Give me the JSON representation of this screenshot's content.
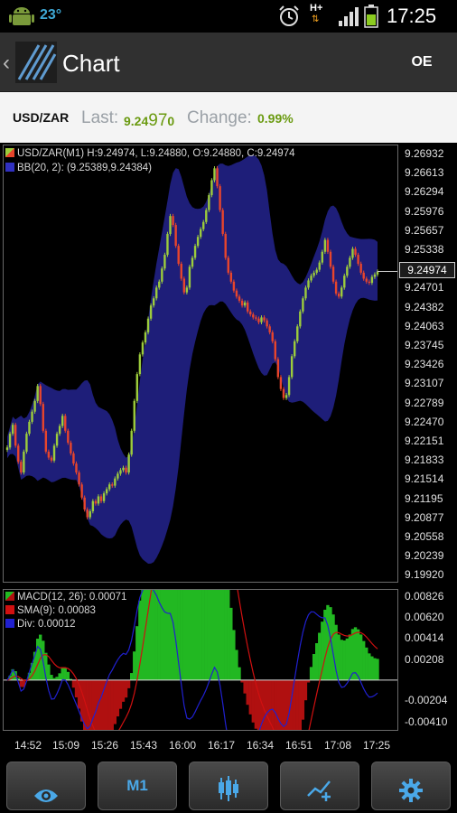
{
  "status_bar": {
    "temperature": "23°",
    "network": "H+",
    "time": "17:25"
  },
  "action_bar": {
    "title": "Chart",
    "oe_label": "OE"
  },
  "quote": {
    "symbol": "USD/ZAR",
    "last_label": "Last:",
    "last_value_prefix": "9.24",
    "last_value_big": "97",
    "last_value_suffix": "0",
    "change_label": "Change:",
    "change_value": "0.99%"
  },
  "main_legend": {
    "series": "USD/ZAR(M1) H:9.24974, L:9.24880, O:9.24880, C:9.24974",
    "bb": "BB(20, 2): (9.25389,9.24384)"
  },
  "macd_legend": {
    "macd": "MACD(12, 26): 0.00071",
    "sma": "SMA(9): 0.00083",
    "div": "Div: 0.00012"
  },
  "last_price_tag": "9.24974",
  "colors": {
    "band": "#202080",
    "up": "#9ccc3c",
    "down": "#e8452c",
    "macd_hist_pos": "#22b822",
    "macd_hist_neg": "#b01010",
    "sma_line": "#d01010",
    "div_line": "#2020d0"
  },
  "toolbar": {
    "m1_label": "M1",
    "icons": [
      "eye-icon",
      "candlestick-icon",
      "add-indicator-icon",
      "gear-icon"
    ]
  },
  "chart_data": {
    "type": "candlestick",
    "title": "",
    "price_ticks": [
      "9.26932",
      "9.26613",
      "9.26294",
      "9.25976",
      "9.25657",
      "9.25338",
      "9.24701",
      "9.24382",
      "9.24063",
      "9.23745",
      "9.23426",
      "9.23107",
      "9.22789",
      "9.22470",
      "9.22151",
      "9.21833",
      "9.21514",
      "9.21195",
      "9.20877",
      "9.20558",
      "9.20239",
      "9.19920"
    ],
    "macd_ticks": [
      "0.00826",
      "0.00620",
      "0.00414",
      "0.00208",
      "-0.00204",
      "-0.00410"
    ],
    "time_ticks": [
      "14:52",
      "15:09",
      "15:26",
      "15:43",
      "16:00",
      "16:17",
      "16:34",
      "16:51",
      "17:08",
      "17:25"
    ],
    "ylim": [
      9.1992,
      9.26932
    ],
    "macd_ylim": [
      -0.0041,
      0.00826
    ],
    "close_prices": [
      9.2202,
      9.2225,
      9.224,
      9.2205,
      9.2178,
      9.216,
      9.2195,
      9.2225,
      9.2245,
      9.2262,
      9.228,
      9.2305,
      9.2275,
      9.223,
      9.2195,
      9.2185,
      9.218,
      9.2205,
      9.2225,
      9.2238,
      9.2255,
      9.223,
      9.221,
      9.2192,
      9.2175,
      9.216,
      9.214,
      9.2118,
      9.2098,
      9.2085,
      9.2095,
      9.2112,
      9.2108,
      9.212,
      9.2112,
      9.2125,
      9.2132,
      9.214,
      9.2138,
      9.215,
      9.2158,
      9.2164,
      9.2168,
      9.216,
      9.219,
      9.223,
      9.228,
      9.2325,
      9.2358,
      9.2378,
      9.2395,
      9.2418,
      9.244,
      9.2452,
      9.247,
      9.248,
      9.2502,
      9.2525,
      9.256,
      9.259,
      9.2575,
      9.254,
      9.251,
      9.2485,
      9.2462,
      9.247,
      9.2505,
      9.252,
      9.254,
      9.2555,
      9.2568,
      9.258,
      9.26,
      9.2625,
      9.265,
      9.267,
      9.264,
      9.26,
      9.256,
      9.252,
      9.2495,
      9.248,
      9.2465,
      9.2455,
      9.2448,
      9.244,
      9.2445,
      9.243,
      9.2425,
      9.242,
      9.2418,
      9.2412,
      9.242,
      9.2415,
      9.2405,
      9.2395,
      9.238,
      9.235,
      9.232,
      9.23,
      9.2285,
      9.229,
      9.232,
      9.2355,
      9.238,
      9.2405,
      9.243,
      9.2452,
      9.247,
      9.2482,
      9.249,
      9.2495,
      9.25,
      9.2512,
      9.253,
      9.255,
      9.253,
      9.2505,
      9.248,
      9.246,
      9.2455,
      9.247,
      9.249,
      9.2505,
      9.252,
      9.2535,
      9.2525,
      9.251,
      9.2495,
      9.2485,
      9.248,
      9.2478,
      9.2488,
      9.2492,
      9.2497
    ]
  }
}
